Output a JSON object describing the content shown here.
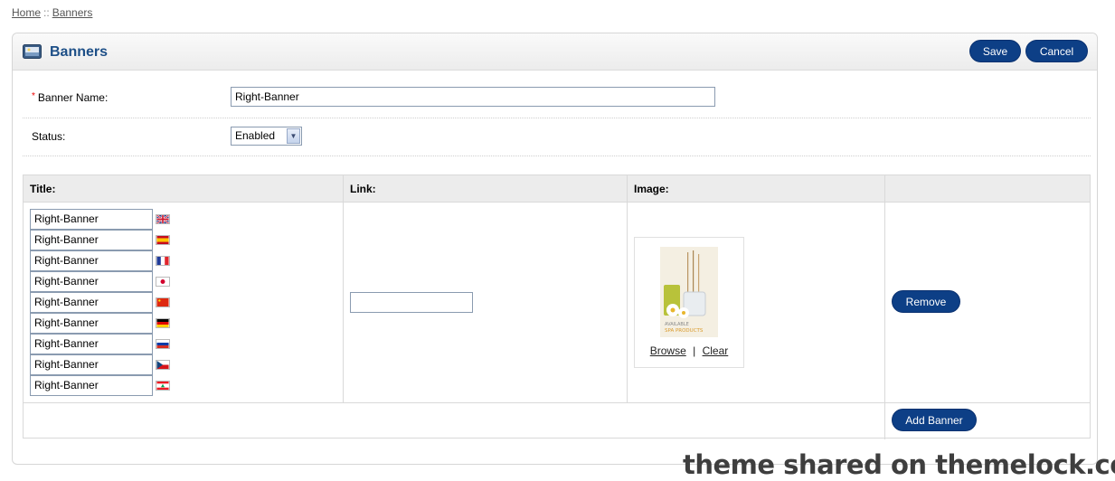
{
  "breadcrumb": {
    "home": "Home",
    "separator": "::",
    "current": "Banners"
  },
  "heading": {
    "title": "Banners",
    "icon": "banner-image-icon"
  },
  "buttons": {
    "save": "Save",
    "cancel": "Cancel",
    "remove": "Remove",
    "add_banner": "Add Banner"
  },
  "form": {
    "required_mark": "*",
    "banner_name_label": "Banner Name:",
    "banner_name_value": "Right-Banner",
    "status_label": "Status:",
    "status_value": "Enabled"
  },
  "table": {
    "headers": {
      "title": "Title:",
      "link": "Link:",
      "image": "Image:"
    },
    "titles": [
      {
        "value": "Right-Banner",
        "flag": "uk-flag-icon"
      },
      {
        "value": "Right-Banner",
        "flag": "spain-flag-icon"
      },
      {
        "value": "Right-Banner",
        "flag": "france-flag-icon"
      },
      {
        "value": "Right-Banner",
        "flag": "japan-flag-icon"
      },
      {
        "value": "Right-Banner",
        "flag": "china-flag-icon"
      },
      {
        "value": "Right-Banner",
        "flag": "germany-flag-icon"
      },
      {
        "value": "Right-Banner",
        "flag": "russia-flag-icon"
      },
      {
        "value": "Right-Banner",
        "flag": "czech-flag-icon"
      },
      {
        "value": "Right-Banner",
        "flag": "lebanon-flag-icon"
      }
    ],
    "link_value": "",
    "image": {
      "caption_line1": "AVAILABLE",
      "caption_line2": "SPA PRODUCTS",
      "browse": "Browse",
      "divider": "|",
      "clear": "Clear"
    }
  },
  "watermark": "theme shared on themelock.com",
  "colors": {
    "button": "#0d3f86",
    "heading_text": "#1d4f87",
    "border": "#d9d9d9"
  }
}
